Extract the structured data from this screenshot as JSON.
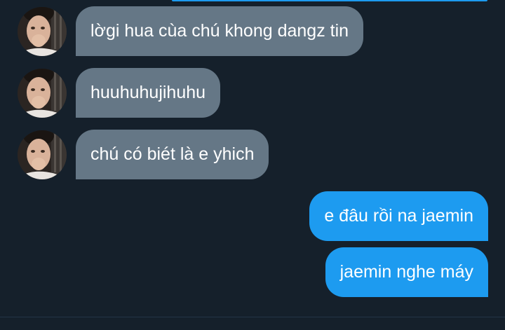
{
  "colors": {
    "background": "#15202b",
    "incoming_bubble": "#657786",
    "outgoing_bubble": "#1d9bf0",
    "text": "#ffffff"
  },
  "conversation": {
    "incoming": [
      {
        "text": "lờgi hua cùa chú khong dangz tin",
        "avatar_icon": "user-avatar"
      },
      {
        "text": "huuhuhujihuhu",
        "avatar_icon": "user-avatar"
      },
      {
        "text": "chú có biét là e yhich",
        "avatar_icon": "user-avatar"
      }
    ],
    "outgoing": [
      {
        "text": "e đâu rồi na jaemin"
      },
      {
        "text": "jaemin nghe máy"
      }
    ]
  }
}
